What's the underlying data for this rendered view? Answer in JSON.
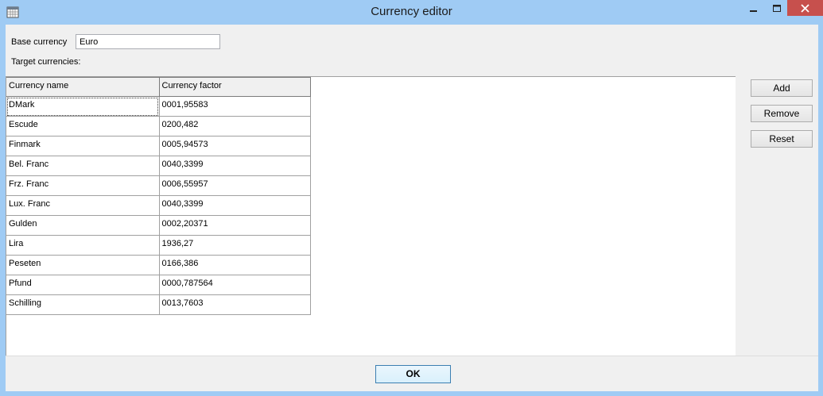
{
  "window": {
    "title": "Currency editor",
    "minimize_glyph": "—",
    "maximize_glyph": "☐",
    "close_glyph": "✕"
  },
  "form": {
    "base_currency_label": "Base currency",
    "base_currency_value": "Euro",
    "target_currencies_label": "Target currencies:"
  },
  "grid": {
    "columns": [
      "Currency name",
      "Currency factor"
    ],
    "rows": [
      [
        "DMark",
        "0001,95583"
      ],
      [
        "Escude",
        "0200,482"
      ],
      [
        "Finmark",
        "0005,94573"
      ],
      [
        "Bel. Franc",
        "0040,3399"
      ],
      [
        "Frz. Franc",
        "0006,55957"
      ],
      [
        "Lux. Franc",
        "0040,3399"
      ],
      [
        "Gulden",
        "0002,20371"
      ],
      [
        "Lira",
        "1936,27"
      ],
      [
        "Peseten",
        "0166,386"
      ],
      [
        "Pfund",
        "0000,787564"
      ],
      [
        "Schilling",
        "0013,7603"
      ]
    ]
  },
  "buttons": {
    "add": "Add",
    "remove": "Remove",
    "reset": "Reset",
    "ok": "OK"
  },
  "colors": {
    "frame": "#9fcbf4",
    "close": "#c7504d",
    "panel": "#f0f0f0"
  }
}
